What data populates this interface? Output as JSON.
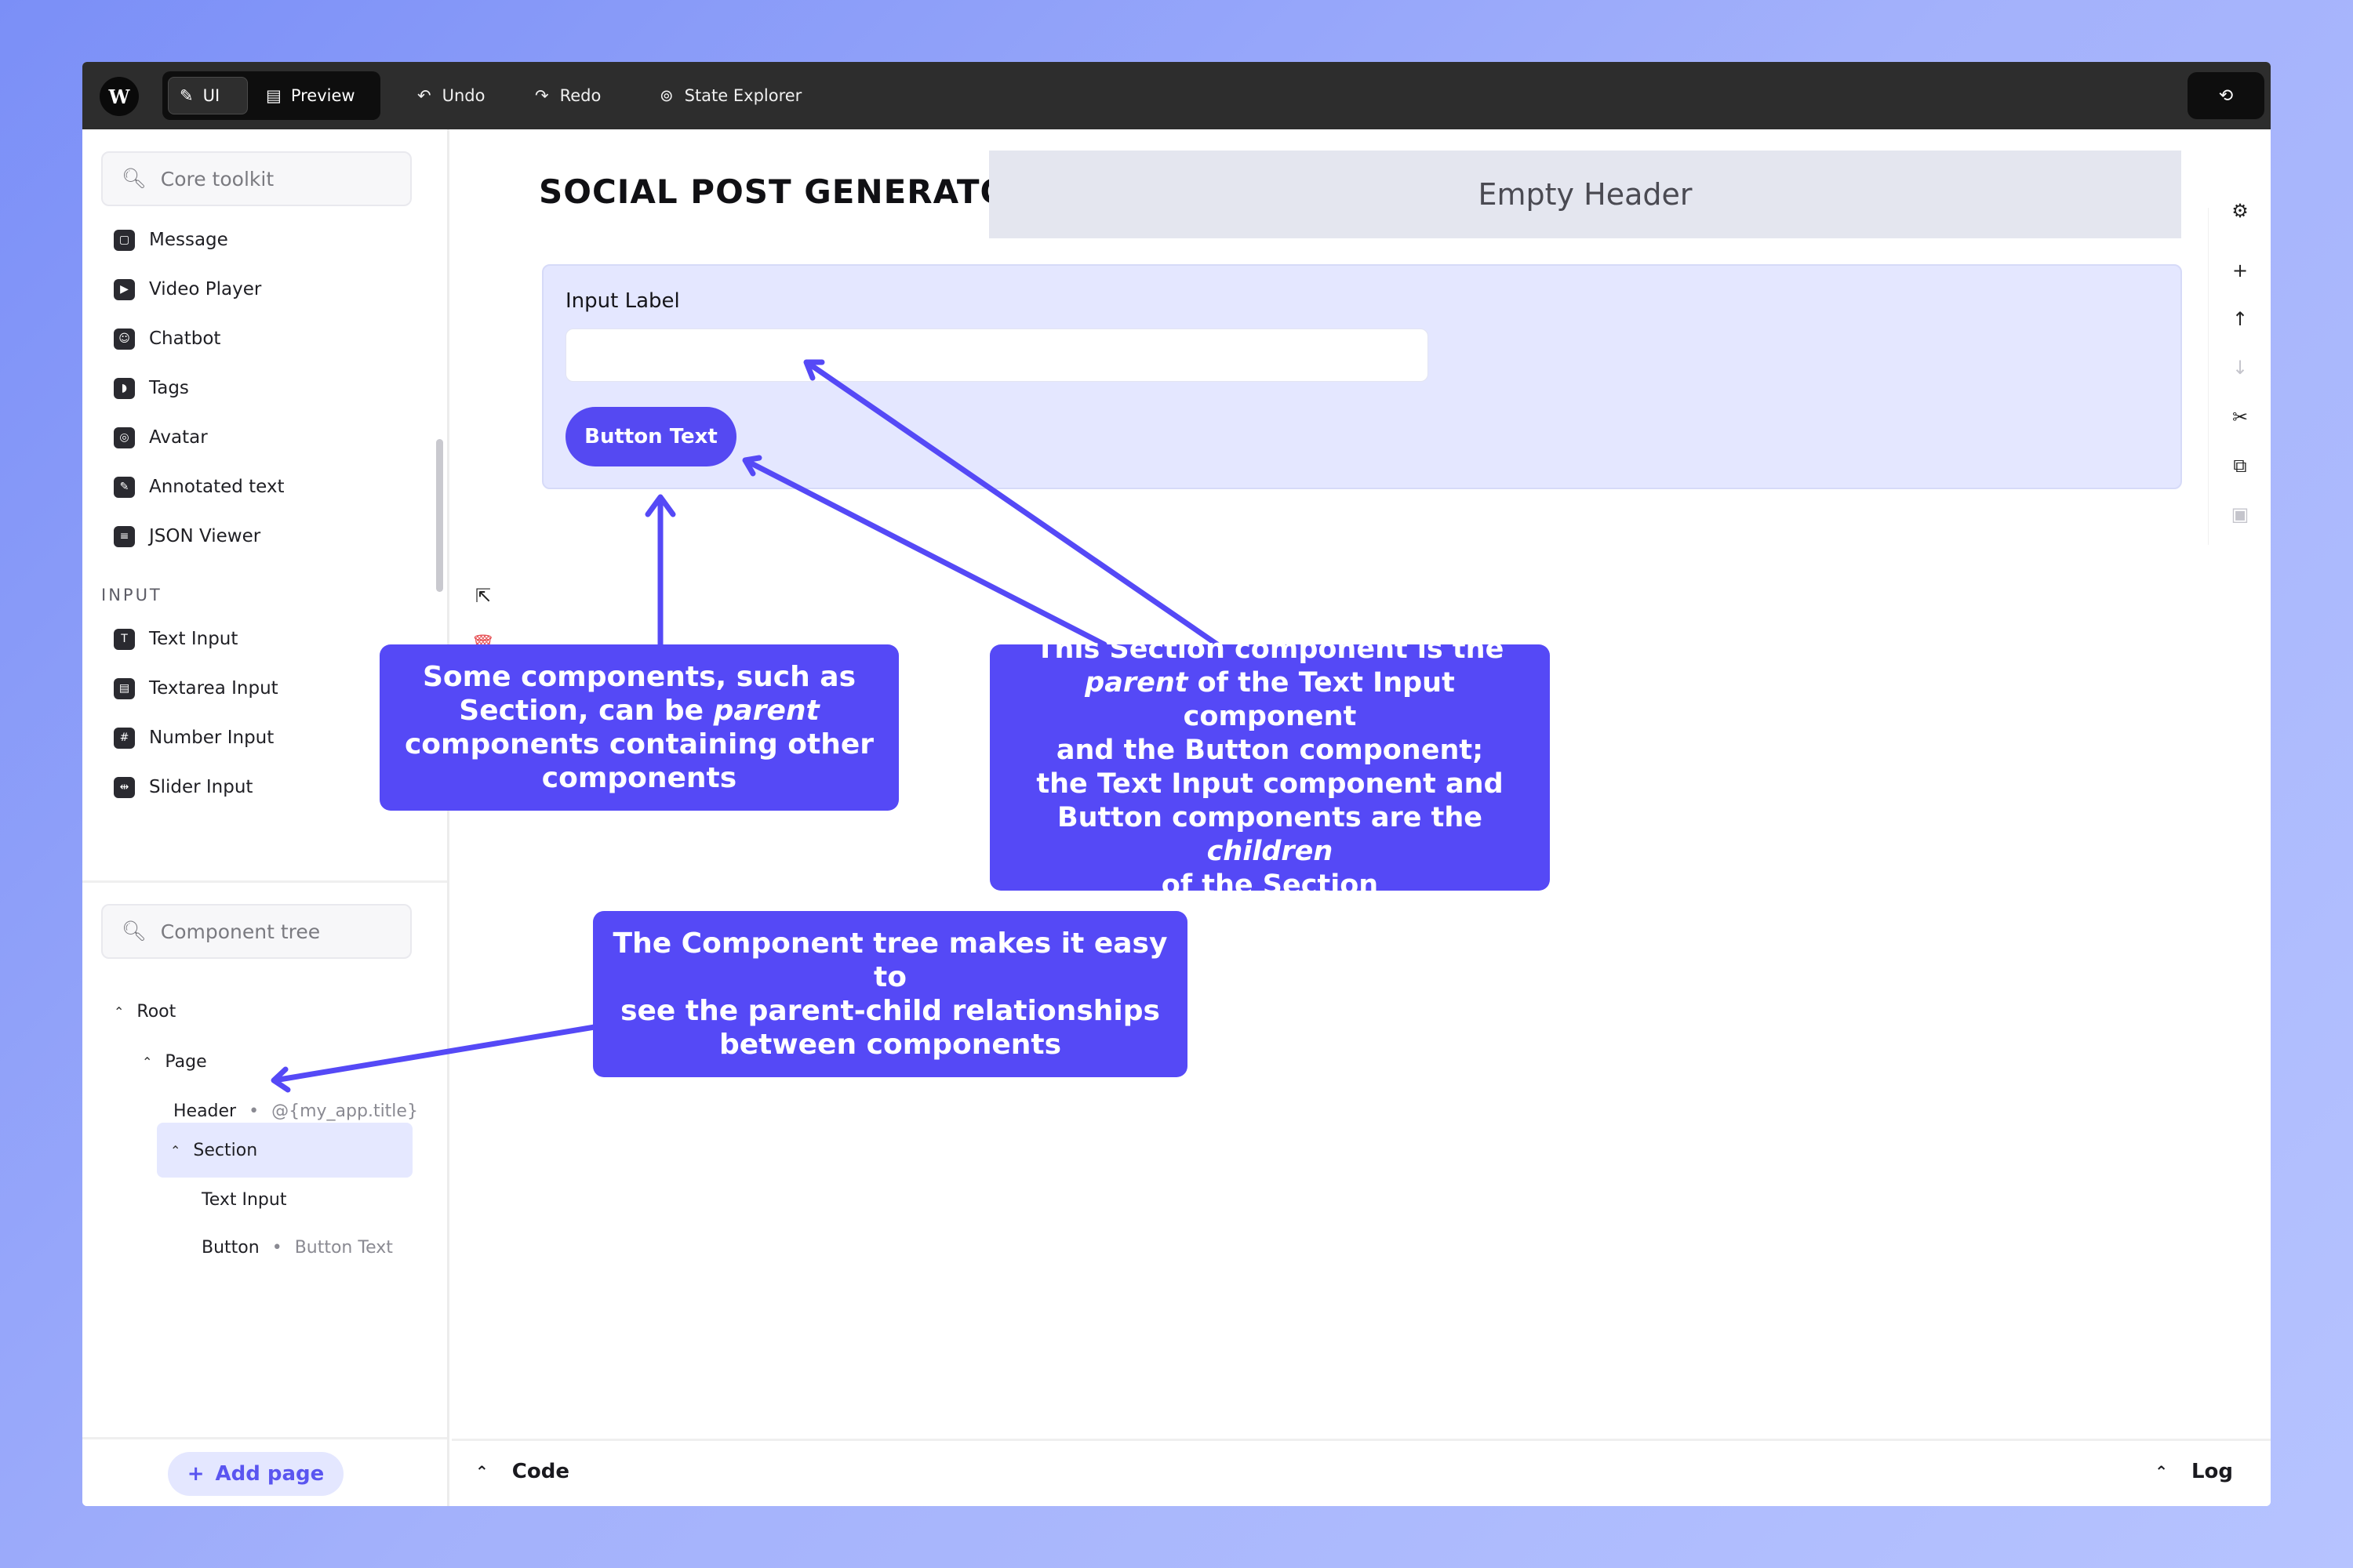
{
  "topbar": {
    "logo": "W",
    "modes": [
      {
        "label": "UI",
        "icon": "pencil-icon"
      },
      {
        "label": "Preview",
        "icon": "preview-icon"
      }
    ],
    "actions": [
      {
        "label": "Undo",
        "icon": "undo-icon"
      },
      {
        "label": "Redo",
        "icon": "redo-icon"
      },
      {
        "label": "State Explorer",
        "icon": "state-explorer-icon"
      }
    ],
    "sync_icon": "sync-icon"
  },
  "sidebar": {
    "toolkit_search_placeholder": "Core toolkit",
    "toolkit_items": [
      "Message",
      "Video Player",
      "Chatbot",
      "Tags",
      "Avatar",
      "Annotated text",
      "JSON Viewer"
    ],
    "input_group_label": "INPUT",
    "input_items": [
      "Text Input",
      "Textarea Input",
      "Number Input",
      "Slider Input"
    ],
    "tree_search_placeholder": "Component tree",
    "tree": {
      "root": "Root",
      "page": "Page",
      "header": {
        "label": "Header",
        "meta": "@{my_app.title}"
      },
      "section": "Section",
      "text_input": "Text Input",
      "button": {
        "label": "Button",
        "meta": "Button Text"
      }
    },
    "add_page": "Add page"
  },
  "canvas": {
    "app_title": "SOCIAL POST GENERATOR",
    "empty_header": "Empty Header",
    "input_label": "Input Label",
    "button_text": "Button Text"
  },
  "bottom": {
    "code": "Code",
    "log": "Log"
  },
  "annotations": {
    "parent_components": {
      "l1": "Some components, such as",
      "l2a": "Section, can be ",
      "l2b": "parent",
      "l3": "components containing other",
      "l4": "components"
    },
    "section_parent": {
      "l1": "This Section component is the",
      "l2a": "parent",
      "l2b": " of the Text Input component",
      "l3": "and the Button component;",
      "l4": "the Text Input component and",
      "l5a": "Button components are the ",
      "l5b": "children",
      "l6": "of the Section"
    },
    "component_tree": {
      "l1": "The Component tree makes it easy to",
      "l2": "see the parent-child relationships",
      "l3": "between components"
    }
  },
  "colors": {
    "accent": "#5549f6",
    "selected_bg": "#e5e8ff",
    "topbar": "#2d2d2d"
  }
}
